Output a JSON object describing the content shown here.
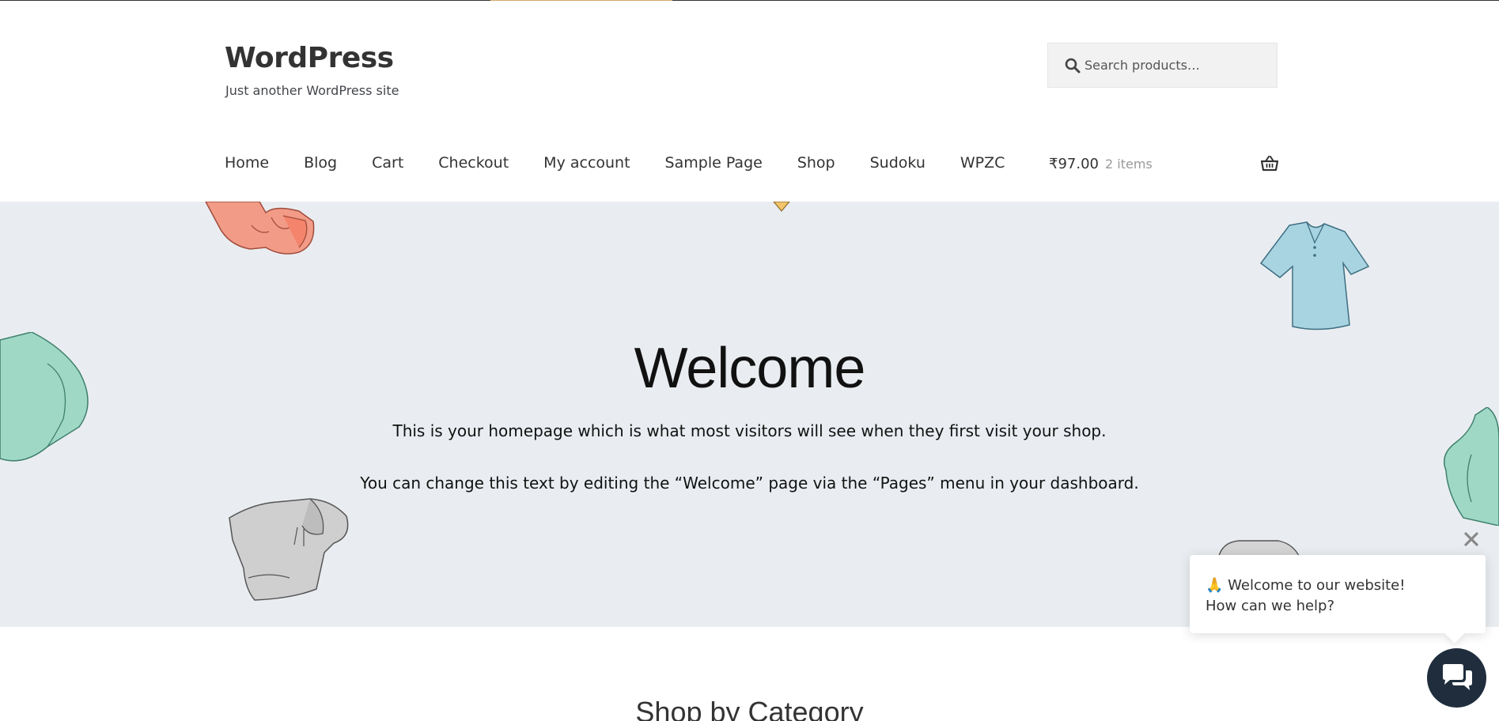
{
  "site": {
    "title": "WordPress",
    "tagline": "Just another WordPress site"
  },
  "search": {
    "placeholder": "Search products…",
    "icon": "search-icon"
  },
  "nav": {
    "items": [
      {
        "label": "Home"
      },
      {
        "label": "Blog"
      },
      {
        "label": "Cart"
      },
      {
        "label": "Checkout"
      },
      {
        "label": "My account"
      },
      {
        "label": "Sample Page"
      },
      {
        "label": "Shop"
      },
      {
        "label": "Sudoku"
      },
      {
        "label": "WPZC"
      }
    ]
  },
  "cart": {
    "amount": "₹97.00",
    "count": "2 items",
    "icon": "basket-icon"
  },
  "hero": {
    "title": "Welcome",
    "line1": "This is your homepage which is what most visitors will see when they first visit your shop.",
    "line2": "You can change this text by editing the “Welcome” page via the “Pages” menu in your dashboard."
  },
  "section": {
    "title": "Shop by Category"
  },
  "chat": {
    "greeting": "🙏 Welcome to our website!",
    "question": "How can we help?"
  },
  "colors": {
    "hero_bg": "#e9edf1",
    "accent": "#d9a86c",
    "chat_launcher": "#1f2d3d",
    "search_bg": "#f2f2f2"
  }
}
